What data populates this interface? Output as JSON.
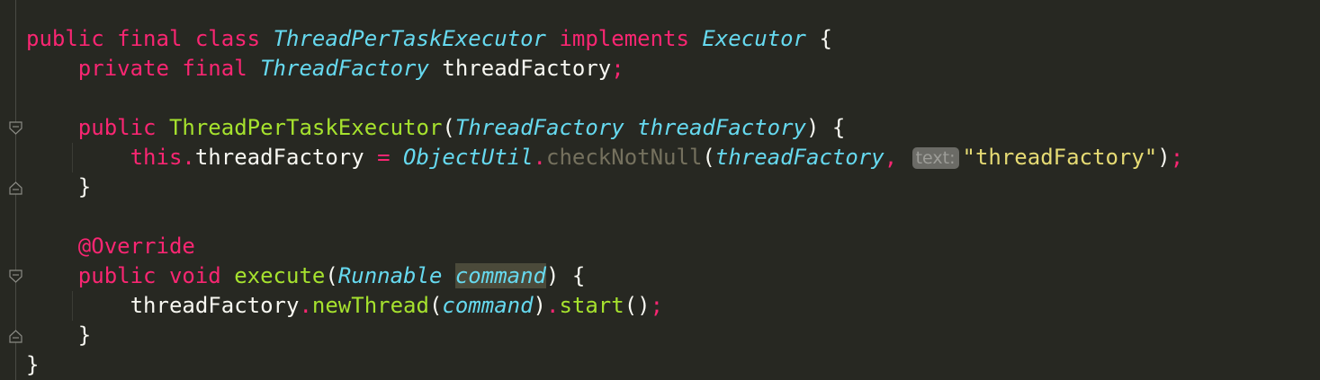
{
  "code": {
    "line1": {
      "public": "public",
      "final": "final",
      "class": "class",
      "class_name": "ThreadPerTaskExecutor",
      "implements": "implements",
      "iface": "Executor",
      "brace": "{"
    },
    "line2": {
      "private": "private",
      "final": "final",
      "type": "ThreadFactory",
      "field": "threadFactory",
      "semi": ";"
    },
    "line4": {
      "public": "public",
      "ctor": "ThreadPerTaskExecutor",
      "open": "(",
      "ptype": "ThreadFactory",
      "pname": "threadFactory",
      "close": ") {"
    },
    "line5": {
      "this": "this",
      "dot": ".",
      "field": "threadFactory",
      "eq": "=",
      "util": "ObjectUtil",
      "dot2": ".",
      "method": "checkNotNull",
      "open": "(",
      "arg": "threadFactory",
      "comma": ",",
      "hint": "text:",
      "str": "\"threadFactory\"",
      "close": ")",
      "semi": ";"
    },
    "line6": {
      "brace": "}"
    },
    "line8": {
      "annotation": "@Override"
    },
    "line9": {
      "public": "public",
      "void": "void",
      "method": "execute",
      "open": "(",
      "ptype": "Runnable",
      "pname": "command",
      "close": ") {"
    },
    "line10": {
      "field": "threadFactory",
      "dot": ".",
      "method": "newThread",
      "open": "(",
      "arg": "command",
      "close": ")",
      "dot2": ".",
      "method2": "start",
      "parens": "()",
      "semi": ";"
    },
    "line11": {
      "brace": "}"
    },
    "line12": {
      "brace": "}"
    }
  },
  "colors": {
    "background": "#272822",
    "keyword": "#f92672",
    "type": "#66d9ef",
    "function": "#a6e22e",
    "string": "#e6db74",
    "plain": "#f8f8f2",
    "dimmed": "#75715e"
  }
}
